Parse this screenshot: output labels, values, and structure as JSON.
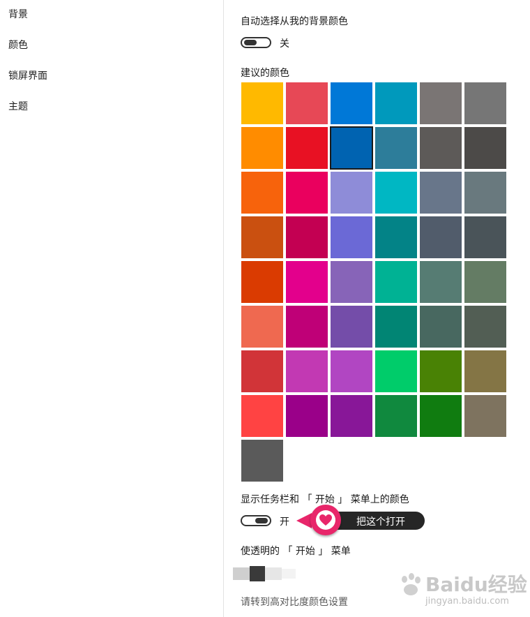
{
  "sidebar": {
    "items": [
      {
        "label": "背景"
      },
      {
        "label": "颜色"
      },
      {
        "label": "锁屏界面"
      },
      {
        "label": "主题"
      }
    ]
  },
  "auto_color": {
    "label": "自动选择从我的背景颜色",
    "state": "关",
    "on": false
  },
  "suggested_colors": {
    "title": "建议的颜色",
    "rows": [
      [
        "#FFB900",
        "#E74856",
        "#0078D7",
        "#0099BC",
        "#7A7574",
        "#767676"
      ],
      [
        "#FF8C00",
        "#E81123",
        "#0063B1",
        "#2D7D9A",
        "#5D5A58",
        "#4C4A48"
      ],
      [
        "#F7630C",
        "#EA005E",
        "#8E8CD8",
        "#00B7C3",
        "#68768A",
        "#69797E"
      ],
      [
        "#CA5010",
        "#C30052",
        "#6B69D6",
        "#038387",
        "#515C6B",
        "#4A5459"
      ],
      [
        "#DA3B01",
        "#E3008C",
        "#8764B8",
        "#00B294",
        "#567C73",
        "#647C64"
      ],
      [
        "#EF6950",
        "#BF0077",
        "#744DA9",
        "#018574",
        "#486860",
        "#525E54"
      ],
      [
        "#D13438",
        "#C239B3",
        "#B146C2",
        "#00CC6A",
        "#498205",
        "#847545"
      ],
      [
        "#FF4343",
        "#9A0089",
        "#881798",
        "#10893E",
        "#107C10",
        "#7E735F"
      ],
      [
        "#5A5A5A"
      ]
    ],
    "selected": "#0063B1"
  },
  "taskbar_color": {
    "label": "显示任务栏和 「 开始 」 菜单上的颜色",
    "state": "开",
    "on": true
  },
  "callout": {
    "text": "把这个打开",
    "accent": "#E8266A"
  },
  "transparency": {
    "label": "使透明的 「 开始 」 菜单"
  },
  "high_contrast_link": "请转到高对比度颜色设置",
  "watermark": {
    "text": "Baidu经验",
    "sub": "jingyan.baidu.com"
  }
}
